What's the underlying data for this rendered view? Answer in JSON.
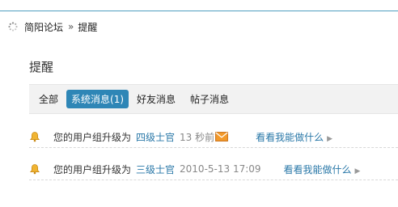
{
  "breadcrumb": {
    "home": "简阳论坛",
    "separator": "»",
    "current": "提醒"
  },
  "page": {
    "title": "提醒"
  },
  "tabs": [
    {
      "label": "全部"
    },
    {
      "label": "系统消息(1)",
      "active": true
    },
    {
      "label": "好友消息"
    },
    {
      "label": "帖子消息"
    }
  ],
  "notices": [
    {
      "message": "您的用户组升级为",
      "group": "四级士官",
      "time": "13 秒前",
      "unread": true,
      "action": "看看我能做什么"
    },
    {
      "message": "您的用户组升级为",
      "group": "三级士官",
      "time": "2010-5-13 17:09",
      "unread": false,
      "action": "看看我能做什么"
    }
  ],
  "colors": {
    "accent": "#2e86b6",
    "link": "#2a78a8",
    "rule": "#4f9fc0"
  },
  "icons": {
    "breadcrumb": "loading-dots-icon",
    "notice": "bell-icon",
    "new_mail": "envelope-icon",
    "more": "chevron-right-icon"
  }
}
